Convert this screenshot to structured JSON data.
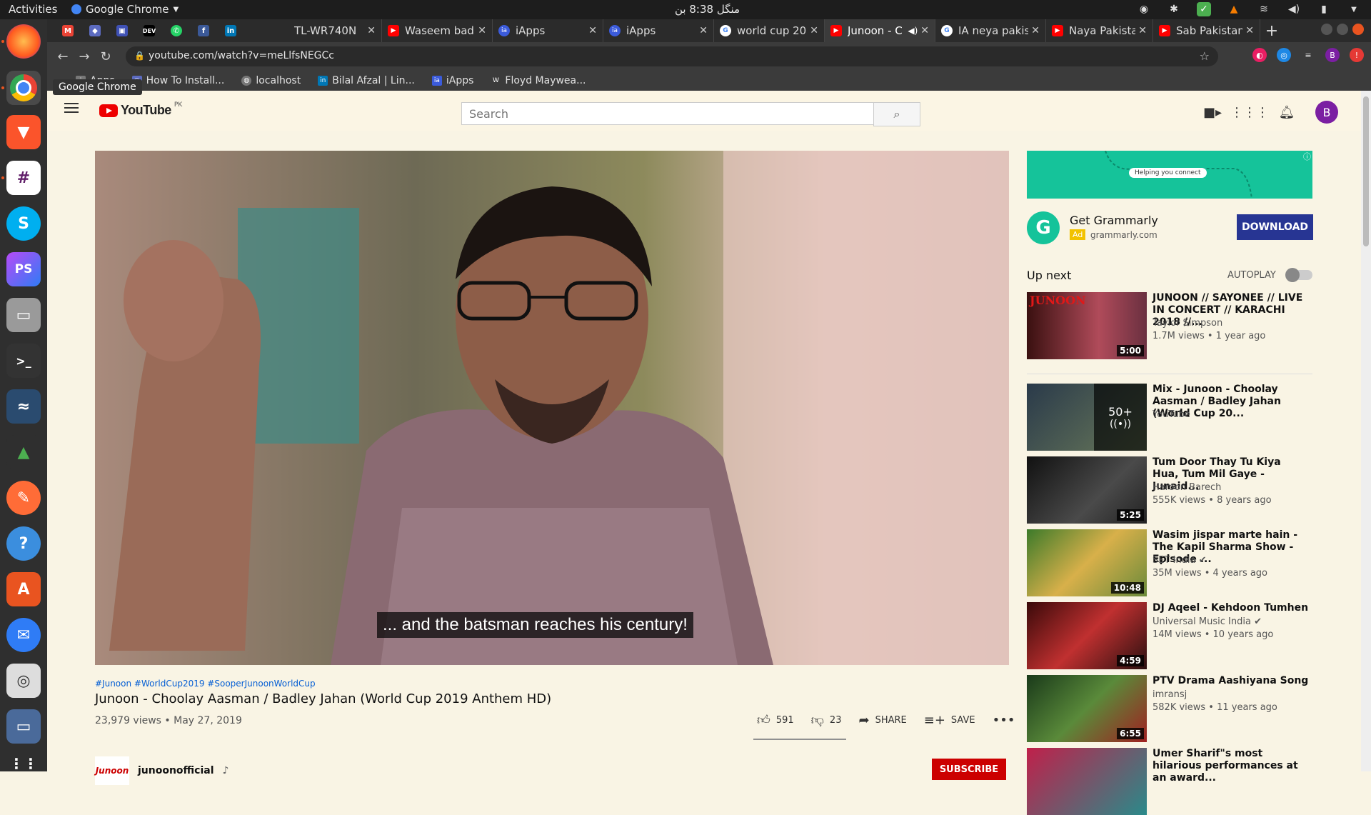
{
  "system_bar": {
    "activities": "Activities",
    "app_name": "Google Chrome",
    "clock": "منگل 8:38 بن"
  },
  "dock_tooltip": "Google Chrome",
  "tabs": [
    {
      "title": "TL-WR740N",
      "favicon_color": "#555555"
    },
    {
      "title": "Waseem bad",
      "favicon_color": "#ff0000"
    },
    {
      "title": "iApps",
      "favicon_color": "#3b5bdb"
    },
    {
      "title": "iApps",
      "favicon_color": "#3b5bdb"
    },
    {
      "title": "world cup 20",
      "favicon_color": "#4285f4"
    },
    {
      "title": "Junoon - C",
      "favicon_color": "#ff0000",
      "active": true
    },
    {
      "title": "IA neya pakis",
      "favicon_color": "#4285f4"
    },
    {
      "title": "Naya Pakistan",
      "favicon_color": "#ff0000"
    },
    {
      "title": "Sab Pakistan",
      "favicon_color": "#ff0000"
    }
  ],
  "address_bar": {
    "url": "youtube.com/watch?v=meLlfsNEGCc"
  },
  "bookmarks": [
    {
      "label": "Apps"
    },
    {
      "label": "How To Install..."
    },
    {
      "label": "localhost"
    },
    {
      "label": "Bilal Afzal | Lin..."
    },
    {
      "label": "iApps"
    },
    {
      "label": "Floyd Maywea..."
    }
  ],
  "youtube": {
    "logo_text": "YouTube",
    "country": "PK",
    "search_placeholder": "Search",
    "avatar_letter": "B",
    "caption": "... and the batsman reaches his century!",
    "tags": "#Junoon #WorldCup2019 #SooperJunoonWorldCup",
    "title": "Junoon - Choolay Aasman / Badley Jahan (World Cup 2019 Anthem HD)",
    "meta": "23,979 views • May 27, 2019",
    "likes": "591",
    "dislikes": "23",
    "share": "SHARE",
    "save": "SAVE",
    "channel": "junoonofficial",
    "channel_logo": "Junoon",
    "subscribe": "SUBSCRIBE"
  },
  "ad": {
    "banner_text": "Helping you connect",
    "title": "Get Grammarly",
    "tag": "Ad",
    "domain": "grammarly.com",
    "cta": "DOWNLOAD"
  },
  "sidebar": {
    "up_next": "Up next",
    "autoplay": "AUTOPLAY",
    "autoplay_on": false,
    "videos": [
      {
        "title": "JUNOON // SAYONEE // LIVE IN CONCERT // KARACHI 2018 //...",
        "channel": "Taylor Simpson",
        "meta": "1.7M views • 1 year ago",
        "duration": "5:00",
        "thumb_color": "#5a2a2a"
      },
      {
        "title": "Mix - Junoon - Choolay Aasman / Badley Jahan (World Cup 20...",
        "channel": "YouTube",
        "meta": "",
        "duration": "",
        "mix_count": "50+",
        "thumb_color": "#3a4a5a"
      },
      {
        "title": "Tum Door Thay Tu Kiya Hua, Tum Mil Gaye - Junaid...",
        "channel": "Haroon Barech",
        "meta": "555K views • 8 years ago",
        "duration": "5:25",
        "thumb_color": "#2a2a2a"
      },
      {
        "title": "Wasim jispar marte hain - The Kapil Sharma Show - Episode ...",
        "channel": "SET India",
        "meta": "35M views • 4 years ago",
        "duration": "10:48",
        "thumb_color": "#4a6a2a"
      },
      {
        "title": "DJ Aqeel - Kehdoon Tumhen",
        "channel": "Universal Music India",
        "meta": "14M views • 10 years ago",
        "duration": "4:59",
        "thumb_color": "#5a1a1a"
      },
      {
        "title": "PTV Drama Aashiyana Song",
        "channel": "imransj",
        "meta": "582K views • 11 years ago",
        "duration": "6:55",
        "thumb_color": "#2a4a2a"
      },
      {
        "title": "Umer Sharif\"s most hilarious performances at an award...",
        "channel": "",
        "meta": "",
        "duration": "",
        "thumb_color": "#c0204a"
      }
    ]
  }
}
